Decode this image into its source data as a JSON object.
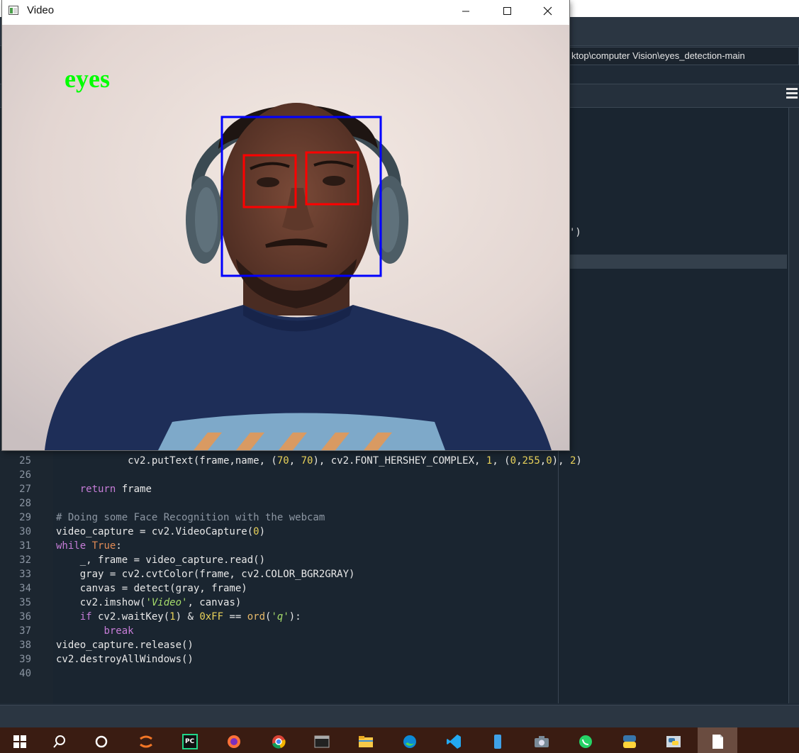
{
  "video_window": {
    "title": "Video",
    "controls": {
      "minimize": "minimize-icon",
      "maximize": "maximize-icon",
      "close": "close-icon"
    },
    "overlay_label": "eyes",
    "colors": {
      "label": "#00ff00",
      "face_box": "#0000ff",
      "eye_box": "#ff0000"
    }
  },
  "editor": {
    "path": "ktop\\computer Vision\\eyes_detection-main",
    "paren_fragment": "')",
    "lines": [
      {
        "n": "25",
        "tokens": [
          {
            "t": "            cv2.putText(frame,name, ("
          },
          {
            "t": "70",
            "c": "num"
          },
          {
            "t": ", "
          },
          {
            "t": "70",
            "c": "num"
          },
          {
            "t": "), cv2.FONT_HERSHEY_COMPLEX, "
          },
          {
            "t": "1",
            "c": "num"
          },
          {
            "t": ", ("
          },
          {
            "t": "0",
            "c": "num"
          },
          {
            "t": ","
          },
          {
            "t": "255",
            "c": "num"
          },
          {
            "t": ","
          },
          {
            "t": "0",
            "c": "num"
          },
          {
            "t": "), "
          },
          {
            "t": "2",
            "c": "num"
          },
          {
            "t": ")"
          }
        ]
      },
      {
        "n": "26",
        "tokens": []
      },
      {
        "n": "27",
        "tokens": [
          {
            "t": "    "
          },
          {
            "t": "return",
            "c": "kw"
          },
          {
            "t": " frame"
          }
        ]
      },
      {
        "n": "28",
        "tokens": []
      },
      {
        "n": "29",
        "tokens": [
          {
            "t": "# Doing some Face Recognition with the webcam",
            "c": "cm"
          }
        ]
      },
      {
        "n": "30",
        "tokens": [
          {
            "t": "video_capture = cv2.VideoCapture("
          },
          {
            "t": "0",
            "c": "num"
          },
          {
            "t": ")"
          }
        ]
      },
      {
        "n": "31",
        "tokens": [
          {
            "t": "while",
            "c": "kw"
          },
          {
            "t": " "
          },
          {
            "t": "True",
            "c": "tr"
          },
          {
            "t": ":"
          }
        ]
      },
      {
        "n": "32",
        "tokens": [
          {
            "t": "    _, frame = video_capture.read()"
          }
        ]
      },
      {
        "n": "33",
        "tokens": [
          {
            "t": "    gray = cv2.cvtColor(frame, cv2.COLOR_BGR2GRAY)"
          }
        ]
      },
      {
        "n": "34",
        "tokens": [
          {
            "t": "    canvas = detect(gray, frame)"
          }
        ]
      },
      {
        "n": "35",
        "tokens": [
          {
            "t": "    cv2.imshow("
          },
          {
            "t": "'Video'",
            "c": "str"
          },
          {
            "t": ", canvas)"
          }
        ]
      },
      {
        "n": "36",
        "tokens": [
          {
            "t": "    "
          },
          {
            "t": "if",
            "c": "kw"
          },
          {
            "t": " cv2.waitKey("
          },
          {
            "t": "1",
            "c": "num"
          },
          {
            "t": ") & "
          },
          {
            "t": "0xFF",
            "c": "num"
          },
          {
            "t": " == "
          },
          {
            "t": "ord",
            "c": "fn"
          },
          {
            "t": "("
          },
          {
            "t": "'q'",
            "c": "str"
          },
          {
            "t": "):"
          }
        ]
      },
      {
        "n": "37",
        "tokens": [
          {
            "t": "        "
          },
          {
            "t": "break",
            "c": "kw"
          }
        ]
      },
      {
        "n": "38",
        "tokens": [
          {
            "t": "video_capture.release()"
          }
        ]
      },
      {
        "n": "39",
        "tokens": [
          {
            "t": "cv2.destroyAllWindows()"
          }
        ]
      },
      {
        "n": "40",
        "tokens": []
      }
    ]
  },
  "taskbar": {
    "items": [
      {
        "icon": "windows-start-icon"
      },
      {
        "icon": "search-icon"
      },
      {
        "icon": "cortana-icon"
      },
      {
        "icon": "jupyter-icon"
      },
      {
        "icon": "pycharm-icon"
      },
      {
        "icon": "firefox-icon"
      },
      {
        "icon": "chrome-icon"
      },
      {
        "icon": "terminal-icon"
      },
      {
        "icon": "file-explorer-icon"
      },
      {
        "icon": "edge-icon"
      },
      {
        "icon": "vscode-icon"
      },
      {
        "icon": "phone-icon"
      },
      {
        "icon": "camera-icon"
      },
      {
        "icon": "whatsapp-icon"
      },
      {
        "icon": "python-icon"
      },
      {
        "icon": "python-idle-icon"
      },
      {
        "icon": "notepad-icon"
      }
    ]
  }
}
